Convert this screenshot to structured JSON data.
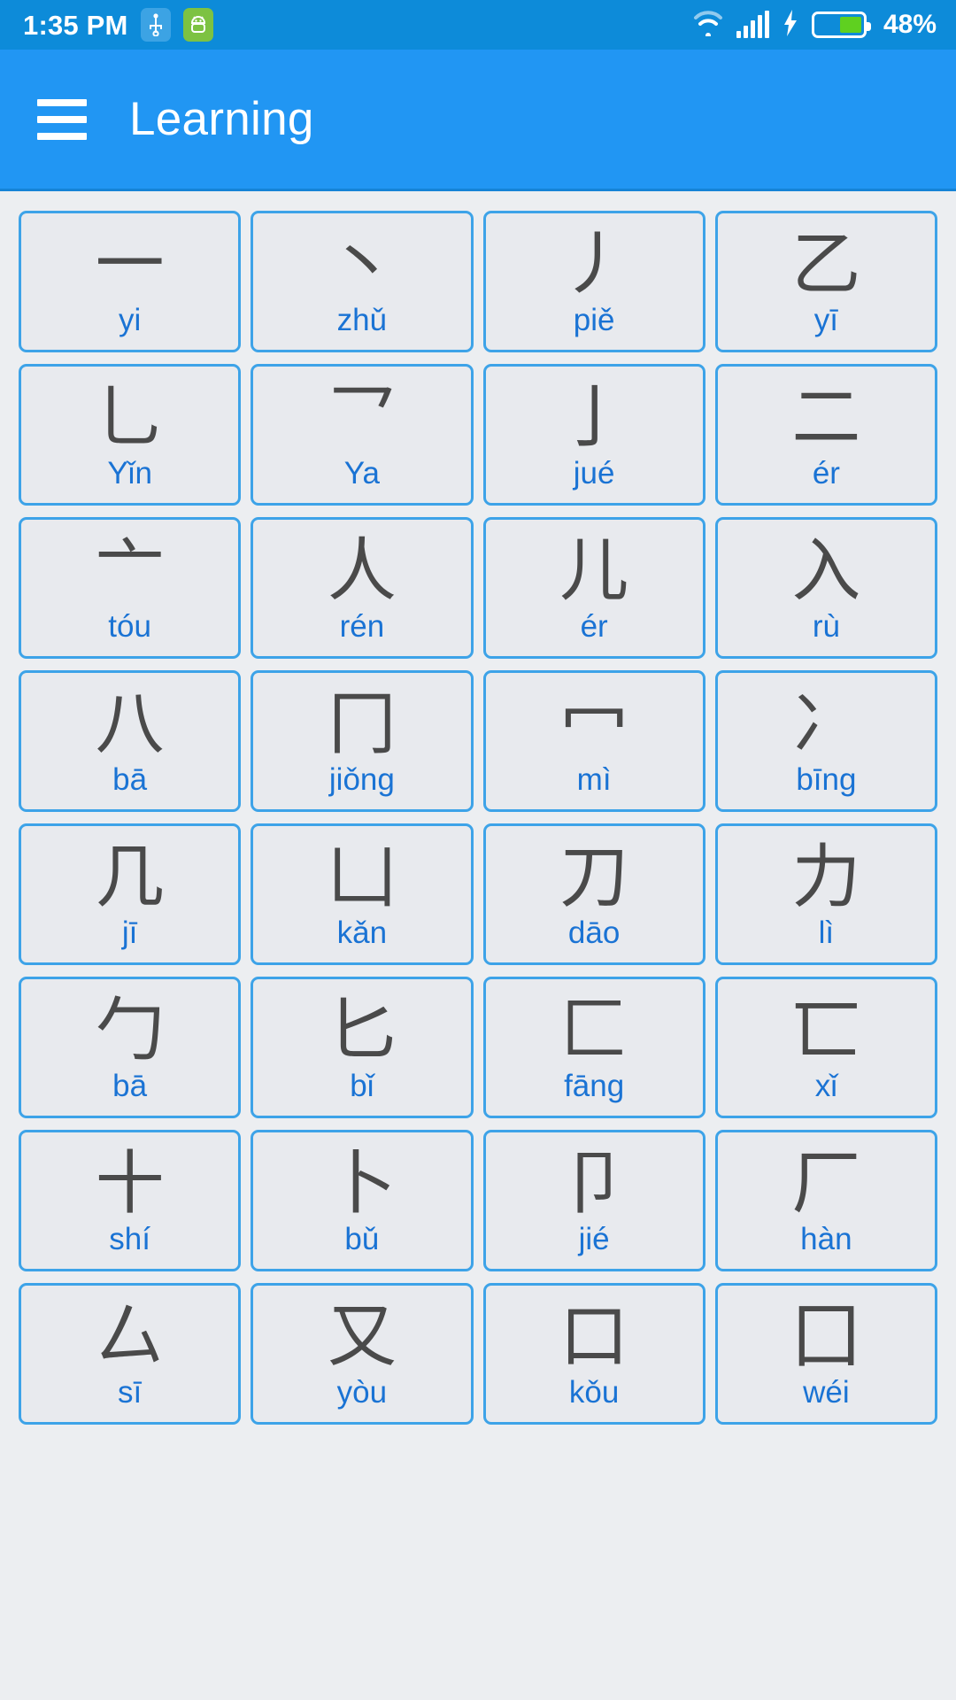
{
  "status_bar": {
    "time": "1:35 PM",
    "battery_percent": "48%",
    "battery_level": 48,
    "icons": [
      "usb-icon",
      "android-icon",
      "wifi-icon",
      "signal-icon",
      "charging-bolt-icon",
      "battery-icon"
    ]
  },
  "app_bar": {
    "menu_icon": "hamburger-menu-icon",
    "title": "Learning"
  },
  "theme": {
    "accent": "#2196f3",
    "status_bar_bg": "#0d8bd9",
    "card_bg": "#e8eaee",
    "card_border": "#3da3e8",
    "glyph_color": "#4a4a4a",
    "pinyin_color": "#1a73d4",
    "page_bg": "#eceef1"
  },
  "grid": {
    "columns": 4,
    "cards": [
      {
        "glyph": "一",
        "pinyin": "yi"
      },
      {
        "glyph": "丶",
        "pinyin": "zhǔ"
      },
      {
        "glyph": "丿",
        "pinyin": "piě"
      },
      {
        "glyph": "乙",
        "pinyin": "yī"
      },
      {
        "glyph": "乚",
        "pinyin": "Yǐn"
      },
      {
        "glyph": "乛",
        "pinyin": "Ya"
      },
      {
        "glyph": "亅",
        "pinyin": "jué"
      },
      {
        "glyph": "二",
        "pinyin": "ér"
      },
      {
        "glyph": "亠",
        "pinyin": "tóu"
      },
      {
        "glyph": "人",
        "pinyin": "rén"
      },
      {
        "glyph": "儿",
        "pinyin": "ér"
      },
      {
        "glyph": "入",
        "pinyin": "rù"
      },
      {
        "glyph": "八",
        "pinyin": "bā"
      },
      {
        "glyph": "冂",
        "pinyin": "jiǒng"
      },
      {
        "glyph": "冖",
        "pinyin": "mì"
      },
      {
        "glyph": "冫",
        "pinyin": "bīng"
      },
      {
        "glyph": "几",
        "pinyin": "jī"
      },
      {
        "glyph": "凵",
        "pinyin": "kǎn"
      },
      {
        "glyph": "刀",
        "pinyin": "dāo"
      },
      {
        "glyph": "力",
        "pinyin": "lì"
      },
      {
        "glyph": "勹",
        "pinyin": "bā"
      },
      {
        "glyph": "匕",
        "pinyin": "bǐ"
      },
      {
        "glyph": "匚",
        "pinyin": "fāng"
      },
      {
        "glyph": "匸",
        "pinyin": "xǐ"
      },
      {
        "glyph": "十",
        "pinyin": "shí"
      },
      {
        "glyph": "卜",
        "pinyin": "bǔ"
      },
      {
        "glyph": "卩",
        "pinyin": "jié"
      },
      {
        "glyph": "厂",
        "pinyin": "hàn"
      },
      {
        "glyph": "厶",
        "pinyin": "sī"
      },
      {
        "glyph": "又",
        "pinyin": "yòu"
      },
      {
        "glyph": "口",
        "pinyin": "kǒu"
      },
      {
        "glyph": "囗",
        "pinyin": "wéi"
      }
    ]
  }
}
